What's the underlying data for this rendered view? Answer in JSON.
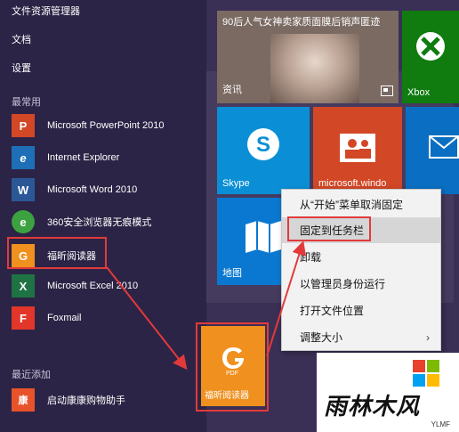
{
  "left_pane": {
    "links": [
      "文件资源管理器",
      "文档",
      "设置"
    ],
    "group_frequent": "最常用",
    "apps": [
      {
        "label": "Microsoft PowerPoint 2010",
        "icon": "powerpoint-icon",
        "glyph": "P",
        "color": "#d24726"
      },
      {
        "label": "Internet Explorer",
        "icon": "internet-explorer-icon",
        "glyph": "e",
        "color": "#1e6fb8"
      },
      {
        "label": "Microsoft Word 2010",
        "icon": "word-icon",
        "glyph": "W",
        "color": "#2b5797"
      },
      {
        "label": "360安全浏览器无痕模式",
        "icon": "360-browser-icon",
        "glyph": "e",
        "color": "#3ca240"
      },
      {
        "label": "福昕阅读器",
        "icon": "foxit-reader-icon",
        "glyph": "G",
        "color": "#f0901e"
      },
      {
        "label": "Microsoft Excel 2010",
        "icon": "excel-icon",
        "glyph": "X",
        "color": "#1f7244"
      },
      {
        "label": "Foxmail",
        "icon": "foxmail-icon",
        "glyph": "F",
        "color": "#e2362a"
      }
    ],
    "group_recent": "最近添加",
    "recent_apps": [
      {
        "label": "启动康康购物助手",
        "icon": "shopping-assistant-icon",
        "glyph": "康",
        "color": "#e8522a"
      }
    ]
  },
  "tiles": {
    "news_headline": "90后人气女神卖家质面膜后销声匿迹",
    "news_label": "资讯",
    "xbox_label": "Xbox",
    "skype_label": "Skype",
    "office_label": "microsoft.windo",
    "maps_label": "地图",
    "foxit_label": "福昕阅读器",
    "foxit_logo_text": "PDF"
  },
  "context_menu": {
    "items": [
      {
        "label": "从“开始”菜单取消固定",
        "highlighted": false
      },
      {
        "label": "固定到任务栏",
        "highlighted": true
      },
      {
        "label": "卸载",
        "highlighted": false
      },
      {
        "label": "以管理员身份运行",
        "highlighted": false
      },
      {
        "label": "打开文件位置",
        "highlighted": false
      },
      {
        "label": "调整大小",
        "highlighted": false,
        "submenu": true
      }
    ]
  },
  "watermark": {
    "brand": "雨林木风",
    "sub": "YLMF"
  },
  "colors": {
    "start_bg": "#2c2446",
    "annotation_red": "#e23a3a",
    "foxit_orange": "#f0901e"
  }
}
